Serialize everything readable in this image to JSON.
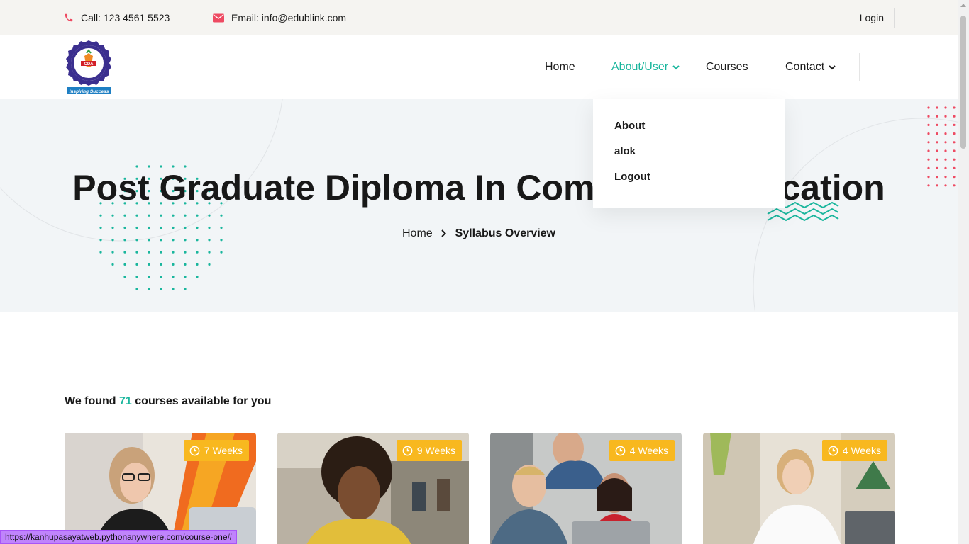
{
  "topbar": {
    "call": "Call: 123 4561 5523",
    "email": "Email: info@edublink.com",
    "login": "Login"
  },
  "logo": {
    "alt": "Career Development Academy",
    "tagline": "Inspiring Success"
  },
  "nav": {
    "home": "Home",
    "about": "About/User",
    "courses": "Courses",
    "contact": "Contact"
  },
  "dropdown": {
    "items": [
      "About",
      "alok",
      "Logout"
    ]
  },
  "hero": {
    "title": "Post Graduate Diploma In Computer Application",
    "breadcrumb_home": "Home",
    "breadcrumb_current": "Syllabus Overview"
  },
  "found": {
    "prefix": "We found ",
    "count": "71",
    "suffix": " courses available for you"
  },
  "courses": [
    {
      "duration": "7 Weeks"
    },
    {
      "duration": "9 Weeks"
    },
    {
      "duration": "4 Weeks"
    },
    {
      "duration": "4 Weeks"
    }
  ],
  "status_url": "https://kanhupasayatweb.pythonanywhere.com/course-one#",
  "colors": {
    "accent": "#1ab69d",
    "badge": "#f8b81f",
    "call_icon": "#ee4a62"
  }
}
